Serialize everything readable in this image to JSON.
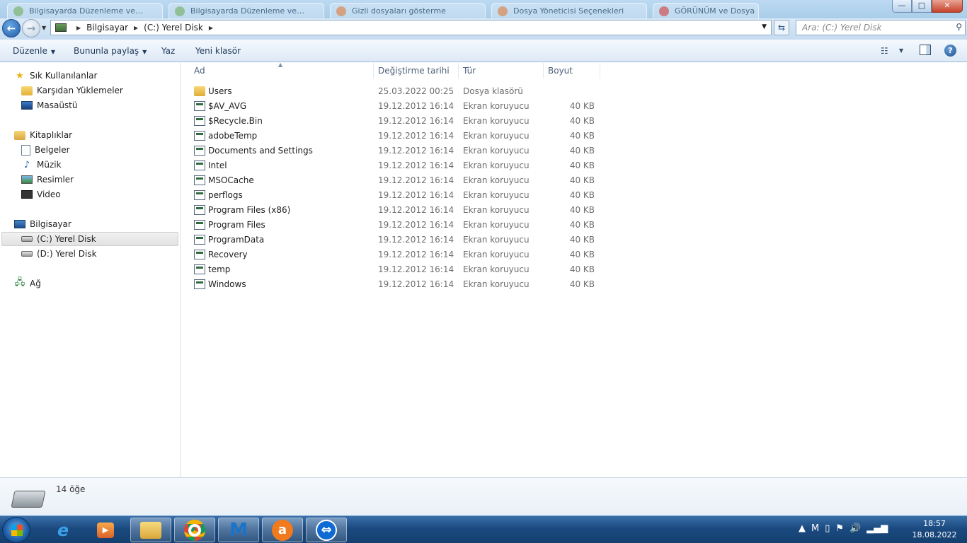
{
  "window": {
    "background_tabs": [
      "Bilgisayarda Düzenleme ve…",
      "Bilgisayarda Düzenleme ve…",
      "Gizli dosyaları gösterme",
      "Dosya Yöneticisi Seçenekleri",
      "GÖRÜNÜM ve Dosya"
    ],
    "controls": {
      "minimize": "—",
      "maximize": "□",
      "close": "✕"
    }
  },
  "address": {
    "crumbs": [
      "Bilgisayar",
      "(C:) Yerel Disk"
    ],
    "search_placeholder": "Ara: (C:) Yerel Disk"
  },
  "toolbar": {
    "organize": "Düzenle",
    "share": "Bununla paylaş",
    "burn": "Yaz",
    "new_folder": "Yeni klasör"
  },
  "sidebar": {
    "favorites": {
      "label": "Sık Kullanılanlar",
      "items": [
        "Karşıdan Yüklemeler",
        "Masaüstü"
      ]
    },
    "libraries": {
      "label": "Kitaplıklar",
      "items": [
        "Belgeler",
        "Müzik",
        "Resimler",
        "Video"
      ]
    },
    "computer": {
      "label": "Bilgisayar",
      "items": [
        "(C:) Yerel Disk",
        "(D:) Yerel Disk"
      ]
    },
    "network": {
      "label": "Ağ"
    }
  },
  "columns": {
    "name": "Ad",
    "date": "Değiştirme tarihi",
    "type": "Tür",
    "size": "Boyut"
  },
  "files": [
    {
      "name": "Users",
      "date": "25.03.2022 00:25",
      "type": "Dosya klasörü",
      "size": "",
      "icon": "folder"
    },
    {
      "name": "$AV_AVG",
      "date": "19.12.2012 16:14",
      "type": "Ekran koruyucu",
      "size": "40 KB",
      "icon": "screensaver"
    },
    {
      "name": "$Recycle.Bin",
      "date": "19.12.2012 16:14",
      "type": "Ekran koruyucu",
      "size": "40 KB",
      "icon": "screensaver"
    },
    {
      "name": "adobeTemp",
      "date": "19.12.2012 16:14",
      "type": "Ekran koruyucu",
      "size": "40 KB",
      "icon": "screensaver"
    },
    {
      "name": "Documents and Settings",
      "date": "19.12.2012 16:14",
      "type": "Ekran koruyucu",
      "size": "40 KB",
      "icon": "screensaver"
    },
    {
      "name": "Intel",
      "date": "19.12.2012 16:14",
      "type": "Ekran koruyucu",
      "size": "40 KB",
      "icon": "screensaver"
    },
    {
      "name": "MSOCache",
      "date": "19.12.2012 16:14",
      "type": "Ekran koruyucu",
      "size": "40 KB",
      "icon": "screensaver"
    },
    {
      "name": "perflogs",
      "date": "19.12.2012 16:14",
      "type": "Ekran koruyucu",
      "size": "40 KB",
      "icon": "screensaver"
    },
    {
      "name": "Program Files (x86)",
      "date": "19.12.2012 16:14",
      "type": "Ekran koruyucu",
      "size": "40 KB",
      "icon": "screensaver"
    },
    {
      "name": "Program Files",
      "date": "19.12.2012 16:14",
      "type": "Ekran koruyucu",
      "size": "40 KB",
      "icon": "screensaver"
    },
    {
      "name": "ProgramData",
      "date": "19.12.2012 16:14",
      "type": "Ekran koruyucu",
      "size": "40 KB",
      "icon": "screensaver"
    },
    {
      "name": "Recovery",
      "date": "19.12.2012 16:14",
      "type": "Ekran koruyucu",
      "size": "40 KB",
      "icon": "screensaver"
    },
    {
      "name": "temp",
      "date": "19.12.2012 16:14",
      "type": "Ekran koruyucu",
      "size": "40 KB",
      "icon": "screensaver"
    },
    {
      "name": "Windows",
      "date": "19.12.2012 16:14",
      "type": "Ekran koruyucu",
      "size": "40 KB",
      "icon": "screensaver"
    }
  ],
  "status": {
    "item_count": "14 öğe"
  },
  "taskbar": {
    "apps": [
      "internet-explorer",
      "media-player",
      "file-explorer",
      "chrome",
      "malwarebytes",
      "avast",
      "teamviewer"
    ],
    "clock_time": "18:57",
    "clock_date": "18.08.2022"
  }
}
